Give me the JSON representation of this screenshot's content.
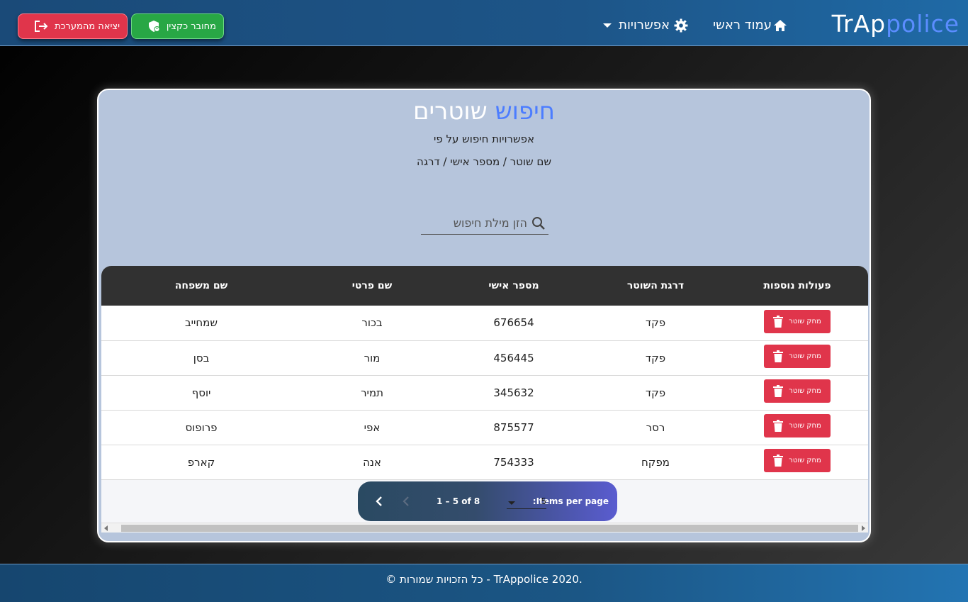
{
  "navbar": {
    "brand_main": "TrAp",
    "brand_accent": "police",
    "home_label": "עמוד ראשי",
    "options_label": "אפשרויות",
    "logout_label": "יציאה מהמערכת",
    "user_label": "מחובר כקצין"
  },
  "card": {
    "title_blue": "חיפוש",
    "title_white": "שוטרים",
    "subtitle_1": "אפשרויות חיפוש על פי",
    "subtitle_2": "שם שוטר / מספר אישי / דרגה",
    "search_placeholder": "הזן מילת חיפוש"
  },
  "table": {
    "headers": {
      "actions": "פעולות נוספות",
      "rank": "דרגת השוטר",
      "personal_id": "מספר אישי",
      "first_name": "שם פרטי",
      "last_name": "שם משפחה"
    },
    "delete_label": "מחק שוטר",
    "rows": [
      {
        "rank": "פקד",
        "personal_id": "676654",
        "first_name": "בכור",
        "last_name": "שמחייב"
      },
      {
        "rank": "פקד",
        "personal_id": "456445",
        "first_name": "מור",
        "last_name": "בסן"
      },
      {
        "rank": "פקד",
        "personal_id": "345632",
        "first_name": "תמיר",
        "last_name": "יוסף"
      },
      {
        "rank": "רסר",
        "personal_id": "875577",
        "first_name": "אפי",
        "last_name": "פרופוס"
      },
      {
        "rank": "מפקח",
        "personal_id": "754333",
        "first_name": "אנה",
        "last_name": "קארפ"
      }
    ]
  },
  "paginator": {
    "items_per_page_label": ":Items per page",
    "items_per_page_value": "5",
    "range_label": "1 – 5 of 8"
  },
  "footer": {
    "text": ".TrAppolice 2020 - כל הזכויות שמורות ©"
  },
  "colors": {
    "accent_blue": "#4c7dff",
    "danger": "#e0354b",
    "success": "#28a745"
  }
}
